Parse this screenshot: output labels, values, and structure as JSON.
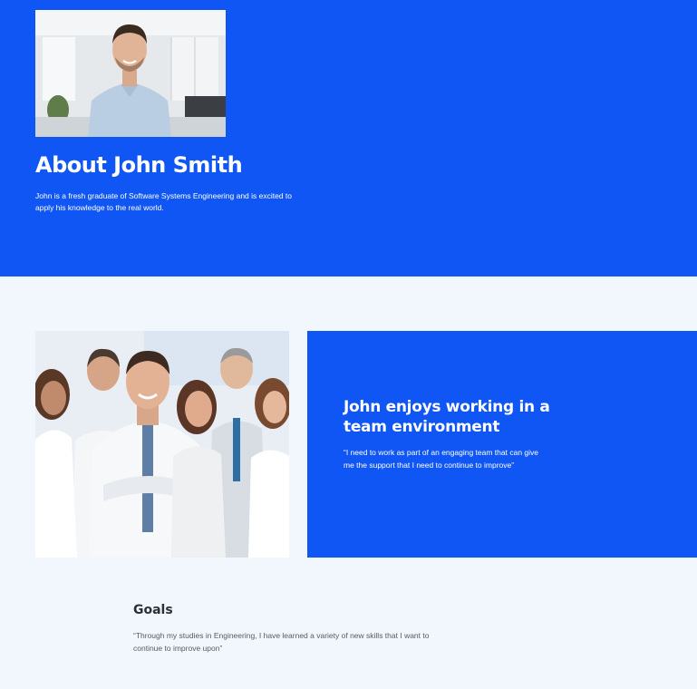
{
  "hero": {
    "title": "About John Smith",
    "description": "John is a fresh graduate of Software Systems Engineering and is excited to apply his knowledge to the real world."
  },
  "team_section": {
    "title": "John enjoys working in a team environment",
    "quote": "“I need to work as part of an engaging team that can give me the support that I need to continue to improve”"
  },
  "goals": {
    "title": "Goals",
    "quote": "“Through my studies in Engineering, I have learned a variety of new skills that I want to continue to improve upon”"
  },
  "colors": {
    "primary_blue": "#0f56f5",
    "page_background": "#f2f6fd",
    "heading_dark": "#2a2f3a",
    "body_gray": "#555b66"
  }
}
